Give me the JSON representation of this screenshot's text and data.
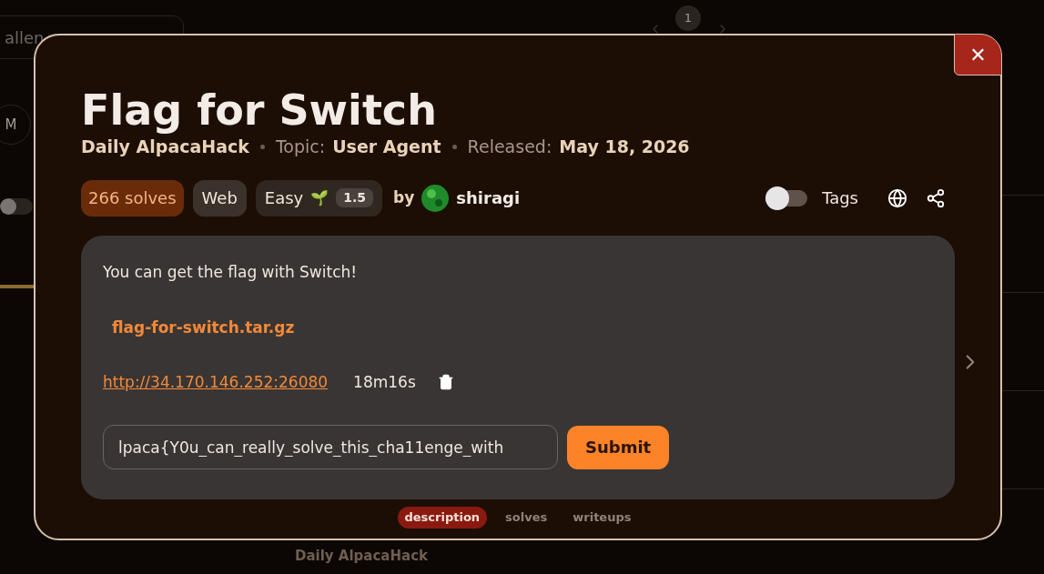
{
  "background": {
    "search_text": "allen",
    "filter_chip": "M",
    "page": "1",
    "card_category": "Daily AlpacaHack",
    "slider": {
      "level": 0
    }
  },
  "modal": {
    "title": "Flag for Switch",
    "meta": [
      {
        "label": "Daily AlpacaHack",
        "kind": "strong"
      },
      {
        "label": "Topic:",
        "kind": "muted"
      },
      {
        "label": "User Agent",
        "kind": "strong"
      },
      {
        "label": "Released:",
        "kind": "muted"
      },
      {
        "label": "May 18, 2026",
        "kind": "strong"
      }
    ],
    "solves": "266 solves",
    "category": "Web",
    "difficulty": "Easy",
    "difficulty_emoji": "🌱",
    "difficulty_score": "1.5",
    "by": "by",
    "author": "shiragi",
    "tags_toggle": {
      "label": "Tags",
      "on": false
    },
    "description": "You can get the flag with Switch!",
    "attachment": "flag-for-switch.tar.gz",
    "instance": {
      "url": "http://34.170.146.252:26080",
      "timer": "18m16s"
    },
    "flag_input": {
      "value": "lpaca{Y0u_can_really_solve_this_cha11enge_with"
    },
    "submit": "Submit",
    "tabs": [
      {
        "label": "description",
        "selected": true
      },
      {
        "label": "solves",
        "selected": false
      },
      {
        "label": "writeups",
        "selected": false
      }
    ],
    "close": "✕"
  }
}
